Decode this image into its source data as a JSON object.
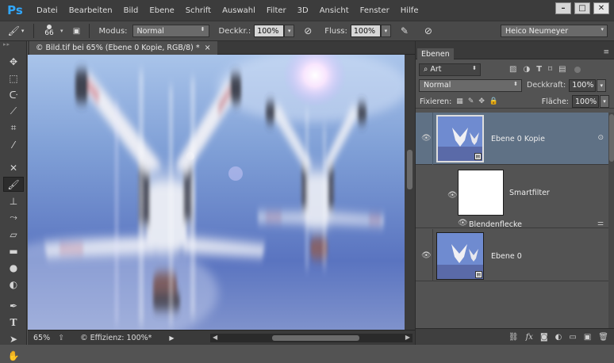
{
  "app": {
    "logo": "Ps"
  },
  "menu": [
    "Datei",
    "Bearbeiten",
    "Bild",
    "Ebene",
    "Schrift",
    "Auswahl",
    "Filter",
    "3D",
    "Ansicht",
    "Fenster",
    "Hilfe"
  ],
  "window_controls": {
    "minimize": "–",
    "maximize": "□",
    "close": "✕"
  },
  "options": {
    "brush_size": "66",
    "mode_label": "Modus:",
    "mode_value": "Normal",
    "opacity_label": "Deckkr.:",
    "opacity_value": "100%",
    "flow_label": "Fluss:",
    "flow_value": "100%",
    "workspace": "Heico Neumeyer"
  },
  "document": {
    "tab_title": "© Bild.tif bei 65% (Ebene 0 Kopie, RGB/8) *",
    "tab_close": "×"
  },
  "status": {
    "zoom": "65%",
    "efficiency": "© Effizienz: 100%*"
  },
  "layers_panel": {
    "tab": "Ebenen",
    "filter_kind": "Art",
    "blend_mode": "Normal",
    "opacity_label": "Deckkraft:",
    "opacity_value": "100%",
    "lock_label": "Fixieren:",
    "fill_label": "Fläche:",
    "fill_value": "100%",
    "layers": [
      {
        "name": "Ebene 0 Kopie",
        "selected": true
      },
      {
        "name": "Smartfilter"
      },
      {
        "name": "Blendenflecke"
      },
      {
        "name": "Ebene 0"
      }
    ]
  },
  "icons": {
    "brush": "brush-icon",
    "move": "move-icon",
    "marquee": "marquee-icon",
    "lasso": "lasso-icon",
    "quick-select": "quick-select-icon",
    "crop": "crop-icon",
    "eyedropper": "eyedropper-icon",
    "healing": "healing-icon",
    "stamp": "stamp-icon",
    "history-brush": "history-brush-icon",
    "eraser": "eraser-icon",
    "gradient": "gradient-icon",
    "blur": "blur-icon",
    "dodge": "dodge-icon",
    "pen": "pen-icon",
    "type": "type-icon",
    "path-select": "path-select-icon",
    "hand": "hand-icon"
  },
  "colors": {
    "accent": "#31a8ff",
    "selected_layer": "#5f7185"
  }
}
